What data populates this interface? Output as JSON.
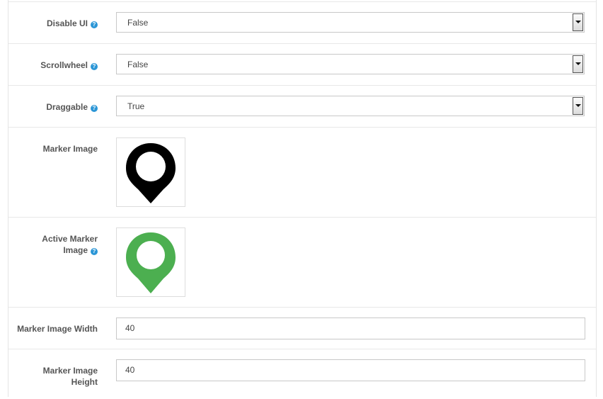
{
  "fields": {
    "disable_ui": {
      "label": "Disable UI",
      "value": "False"
    },
    "scrollwheel": {
      "label": "Scrollwheel",
      "value": "False"
    },
    "draggable": {
      "label": "Draggable",
      "value": "True"
    },
    "marker_image": {
      "label": "Marker Image"
    },
    "active_marker_image": {
      "label_line1": "Active Marker",
      "label_line2": "Image"
    },
    "marker_image_width": {
      "label": "Marker Image Width",
      "value": "40"
    },
    "marker_image_height": {
      "label_line1": "Marker Image",
      "label_line2": "Height",
      "value": "40"
    }
  },
  "help_glyph": "?",
  "icons": {
    "marker": "map-pin-icon",
    "active_marker": "map-pin-icon",
    "help": "question-circle-icon",
    "dropdown": "caret-down-icon"
  },
  "colors": {
    "help_badge": "#2b96d6",
    "marker_black": "#000000",
    "marker_green": "#4caf50"
  }
}
